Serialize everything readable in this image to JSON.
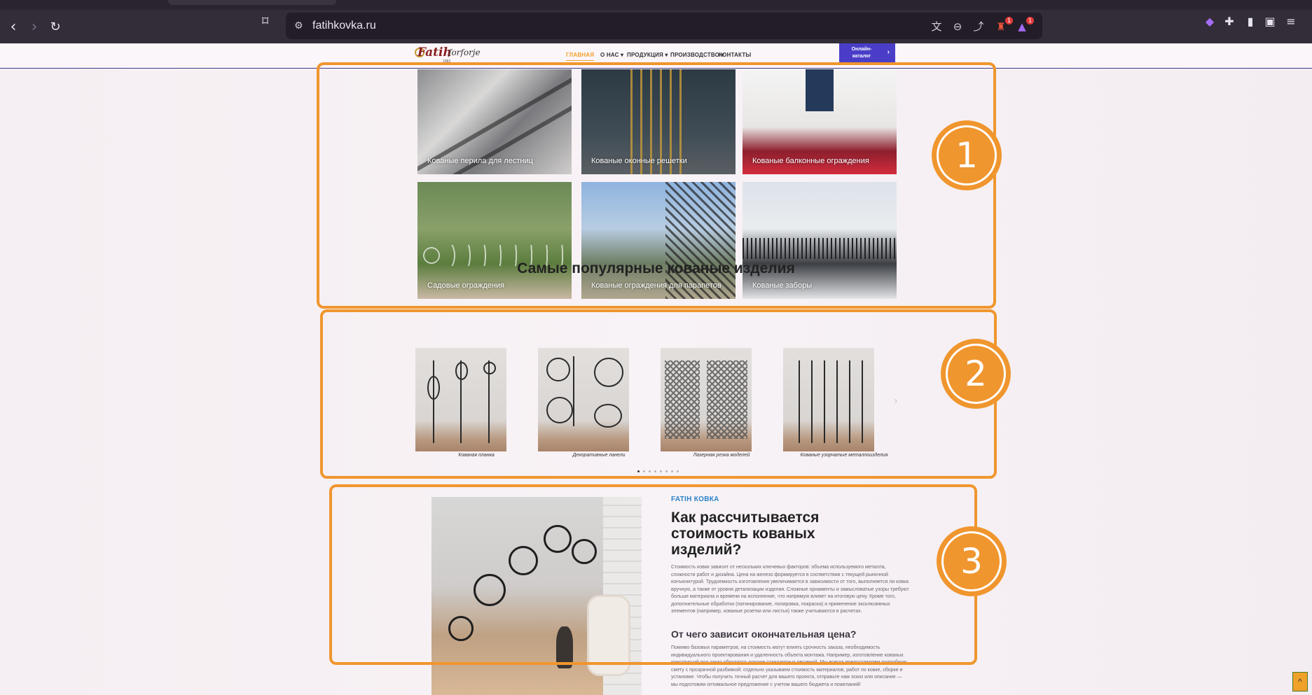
{
  "browser": {
    "url": "fatihkovka.ru",
    "extension_badges": {
      "brave_shields": "1",
      "brave_rewards": "1"
    }
  },
  "site": {
    "logo": {
      "brand": "Fatih",
      "script": "forforje",
      "year": "1983"
    },
    "nav": [
      "ГЛАВНАЯ",
      "О НАС ▾",
      "ПРОДУКЦИЯ ▾",
      "ПРОИЗВОДСТВО ▾",
      "КОНТАКТЫ"
    ],
    "catalog_button": "Онлайн-каталог",
    "catalog_arrow": "›"
  },
  "categories": [
    "Кованые перила для лестниц",
    "Кованые оконные решетки",
    "Кованые балконные ограждения",
    "Садовые ограждения",
    "Кованые ограждения для парапетов",
    "Кованые заборы"
  ],
  "popular": {
    "title": "Самые популярные кованые изделия",
    "items": [
      "Кованая планка",
      "Декоративные панели",
      "Лазерная резка моделей",
      "Кованые узорчатые металлоизделия"
    ],
    "dots": 8,
    "active_dot": 0,
    "prev": "‹",
    "next": "›"
  },
  "cost": {
    "kicker": "FATIH КОВКА",
    "title": "Как рассчитывается стоимость кованых изделий?",
    "paragraph1": "Стоимость ковки зависит от нескольких ключевых факторов: объема используемого металла, сложности работ и дизайна. Цена на железо формируется в соответствии с текущей рыночной конъюнктурой. Трудоемкость изготовления увеличивается в зависимости от того, выполняется ли ковка вручную, а также от уровня детализации изделия. Сложные орнаменты и замысловатые узоры требуют больше материала и времени на исполнение, что напрямую влияет на итоговую цену. Кроме того, дополнительные обработки (патинирование, полировка, покраска) и применение эксклюзивных элементов (например, кованые розетки или листья) также учитываются в расчетах.",
    "subtitle": "От чего зависит окончательная цена?",
    "paragraph2": "Помимо базовых параметров, на стоимость могут влиять срочность заказа, необходимость индивидуального проектирования и удаленность объекта монтажа. Например, изготовление кованых конструкций под заказ обходится дороже стандартных решений. Мы всегда предоставляем подробную смету с прозрачной разбивкой: отдельно указываем стоимость материалов, работ по ковке, сборке и установке. Чтобы получить точный расчет для вашего проекта, отправьте нам эскиз или описание — мы подготовим оптимальное предложение с учетом вашего бюджета и пожеланий!"
  },
  "annotations": [
    "1",
    "2",
    "3"
  ],
  "scroll_top": "^",
  "colors": {
    "annotation": "#f0962e",
    "catalog": "#4a3ec9",
    "active_nav": "#f0a02a",
    "kicker": "#2a82c9"
  }
}
